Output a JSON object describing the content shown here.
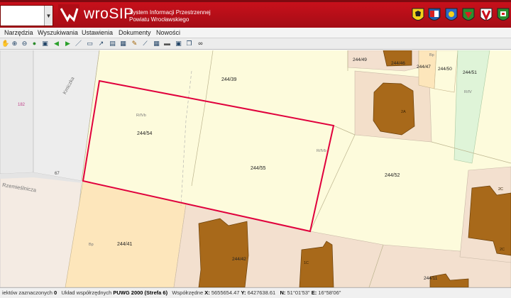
{
  "header": {
    "brand_title": "wroSIP",
    "brand_subtitle_line1": "System Informacji Przestrzennej",
    "brand_subtitle_line2": "Powiatu Wrocławskiego",
    "crests": [
      "crest-1",
      "crest-2",
      "crest-3",
      "crest-4",
      "crest-5",
      "crest-6"
    ],
    "colors": {
      "brand_red": "#c8101b"
    }
  },
  "menu": {
    "items": [
      "Narzędzia",
      "Wyszukiwania",
      "Ustawienia",
      "Dokumenty",
      "Nowości"
    ]
  },
  "toolbar": {
    "icons": [
      "pan-icon",
      "zoom-in-icon",
      "zoom-out-icon",
      "zoom-full-icon",
      "zoom-window-icon",
      "back-icon",
      "forward-icon",
      "measure-line-icon",
      "print-icon",
      "info-icon",
      "layers-icon",
      "legend-icon",
      "draw-icon",
      "chart-icon",
      "grid-icon",
      "table-icon",
      "save-icon",
      "copy-icon",
      "link-icon"
    ]
  },
  "map": {
    "parcels": {
      "p1": "244/54",
      "p2": "244/55",
      "p3": "244/52",
      "p4": "244/39",
      "p5": "244/41",
      "p6": "244/49",
      "p7": "244/46",
      "p8": "244/47",
      "p9": "244/50",
      "p10": "244/51",
      "p11": "244/42",
      "p12": "244/11"
    },
    "streets": {
      "s1": "Kmiczka",
      "s2": "Rzemieślnicza"
    },
    "small_labels": {
      "l1": "182",
      "l2": "67",
      "l3": "R/IVb",
      "l4": "R/IVb",
      "l5": "R/IV",
      "l6": "Bp",
      "l7": "Bp",
      "l8": "2A",
      "l9": "2C",
      "l10": "2C",
      "l11": "1C"
    }
  },
  "status": {
    "selected_label": "iektów zaznaczonych",
    "selected_count": "0",
    "crs_label": "Układ współrzędnych",
    "crs_value": "PUWG 2000 (Strefa 6)",
    "coords_label": "Współrzędne",
    "x_label": "X:",
    "x_value": "5655654.47",
    "y_label": "Y:",
    "y_value": "6427638.61",
    "n_label": "N:",
    "n_value": "51°01'53\"",
    "e_label": "E:",
    "e_value": "16°58'06\""
  }
}
